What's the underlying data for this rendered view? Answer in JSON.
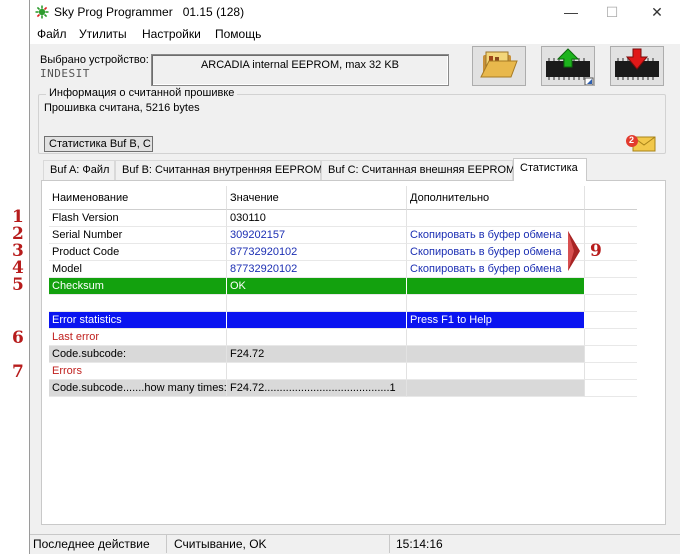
{
  "app": {
    "title": "Sky Prog Programmer   01.15 (128)"
  },
  "window_controls": {
    "minimize": "—",
    "maximize": "☐",
    "close": "✕"
  },
  "menu": [
    "Файл",
    "Утилиты",
    "Настройки",
    "Помощь"
  ],
  "device": {
    "label": "Выбрано устройство:",
    "brand": "INDESIT",
    "name": "ARCADIA internal EEPROM, max 32 KB"
  },
  "toolbar": {
    "open_icon": "folder-open-icon",
    "upload_icon": "chip-upload-green-icon",
    "download_icon": "chip-download-red-icon"
  },
  "firmware_info": {
    "title": "Информация о считанной прошивке",
    "read_text": "Прошивка считана, 5216 bytes",
    "stat_button": "Статистика Buf B, C",
    "mail_badge": "2"
  },
  "tabs": [
    {
      "label": "Buf A: Файл",
      "active": false
    },
    {
      "label": "Buf B: Считанная внутренняя EEPROM",
      "active": false
    },
    {
      "label": "Buf C: Считанная внешняя EEPROM",
      "active": false
    },
    {
      "label": "Статистика",
      "active": true
    }
  ],
  "grid": {
    "headers": [
      "Наименование",
      "Значение",
      "Дополнительно",
      ""
    ],
    "rows": [
      {
        "name": "Flash Version",
        "value": "030110",
        "extra": "",
        "style": "plain"
      },
      {
        "name": "Serial Number",
        "value": "309202157",
        "extra": "Скопировать в буфер обмена",
        "style": "link"
      },
      {
        "name": "Product Code",
        "value": "87732920102",
        "extra": "Скопировать в буфер обмена",
        "style": "link"
      },
      {
        "name": "Model",
        "value": "87732920102",
        "extra": "Скопировать в буфер обмена",
        "style": "link"
      },
      {
        "name": "Checksum",
        "value": "OK",
        "extra": "",
        "style": "green"
      },
      {
        "name": "",
        "value": "",
        "extra": "",
        "style": "plain"
      },
      {
        "name": "Error statistics",
        "value": "",
        "extra": "Press F1 to Help",
        "style": "blue"
      },
      {
        "name": "Last error",
        "value": "",
        "extra": "",
        "style": "red"
      },
      {
        "name": "Code.subcode:",
        "value": "F24.72",
        "extra": "",
        "style": "gray"
      },
      {
        "name": "Errors",
        "value": "",
        "extra": "",
        "style": "red"
      },
      {
        "name": "Code.subcode.......how many times:",
        "value": "F24.72.........................................1",
        "extra": "",
        "style": "gray"
      }
    ],
    "colors": {
      "green": "#13a10e",
      "blue": "#0a14f0",
      "gray": "#d9d9d9",
      "link": "#1c2fb3",
      "red": "#c0201e"
    }
  },
  "annotations": [
    "1",
    "2",
    "3",
    "4",
    "5",
    "6",
    "7",
    "9"
  ],
  "status": {
    "last_action_label": "Последнее действие",
    "last_action_value": "Считывание, OK",
    "time": "15:14:16"
  }
}
